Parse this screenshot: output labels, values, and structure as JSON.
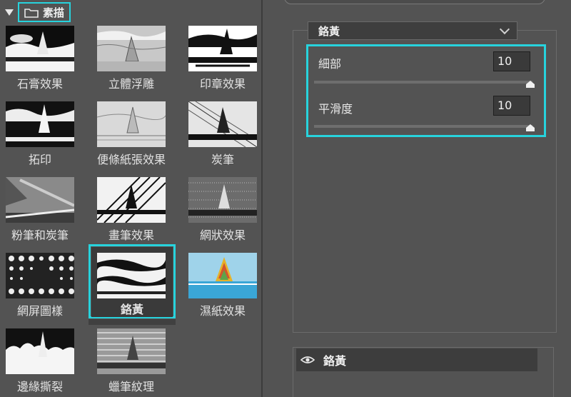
{
  "category": {
    "label": "素描",
    "icon": "folder-icon",
    "expand_icon": "expand-triangle-icon"
  },
  "filters": [
    {
      "label": "石膏效果"
    },
    {
      "label": "立體浮雕"
    },
    {
      "label": "印章效果"
    },
    {
      "label": "拓印"
    },
    {
      "label": "便條紙張效果"
    },
    {
      "label": "炭筆"
    },
    {
      "label": "粉筆和炭筆"
    },
    {
      "label": "畫筆效果"
    },
    {
      "label": "網狀效果"
    },
    {
      "label": "網屏圖樣"
    },
    {
      "label": "鉻黃",
      "selected": true
    },
    {
      "label": "濕紙效果"
    },
    {
      "label": "邊緣撕裂"
    },
    {
      "label": "蠟筆紋理"
    }
  ],
  "panel": {
    "filter_select": "鉻黃",
    "params": [
      {
        "label": "細部",
        "value": "10",
        "level": 1.0
      },
      {
        "label": "平滑度",
        "value": "10",
        "level": 1.0
      }
    ]
  },
  "layers": [
    {
      "label": "鉻黃",
      "icon": "eye-icon"
    }
  ],
  "colors": {
    "highlight": "#27d3dd",
    "background": "#535353"
  }
}
